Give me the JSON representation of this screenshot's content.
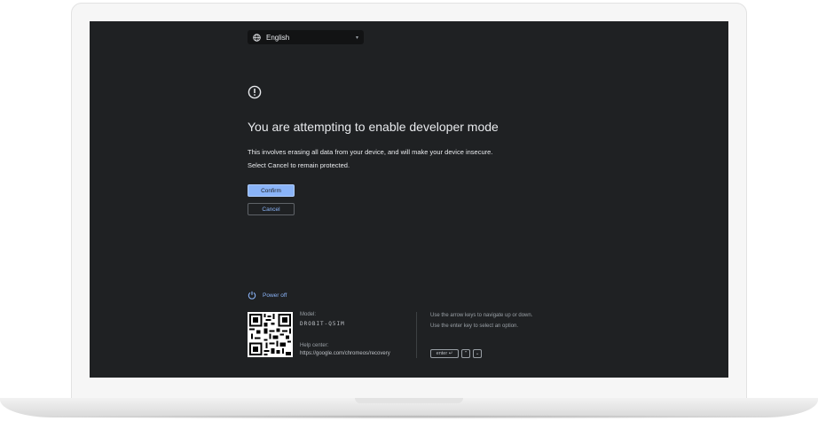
{
  "language_selector": {
    "icon": "globe-icon",
    "label": "English",
    "caret": "▾"
  },
  "alert": {
    "icon": "alert-circle-icon"
  },
  "title": "You are attempting to enable developer mode",
  "description": {
    "line1": "This involves erasing all data from your device, and will make your device insecure.",
    "line2": "Select Cancel to remain protected."
  },
  "buttons": {
    "confirm": "Confirm",
    "cancel": "Cancel"
  },
  "power": {
    "icon": "power-icon",
    "label": "Power off"
  },
  "footer": {
    "model_label": "Model:",
    "model_value": "DROBIT-Q5IM",
    "help_label": "Help center:",
    "help_value": "https://google.com/chromeos/recovery",
    "hint1": "Use the arrow keys to navigate up or down.",
    "hint2": "Use the enter key to select an option.",
    "key_enter": "enter ↵",
    "key_up": "⌃",
    "key_down": "⌄"
  },
  "colors": {
    "screen_bg": "#1f2123",
    "accent": "#8ab4f8",
    "text": "#e8eaed"
  }
}
